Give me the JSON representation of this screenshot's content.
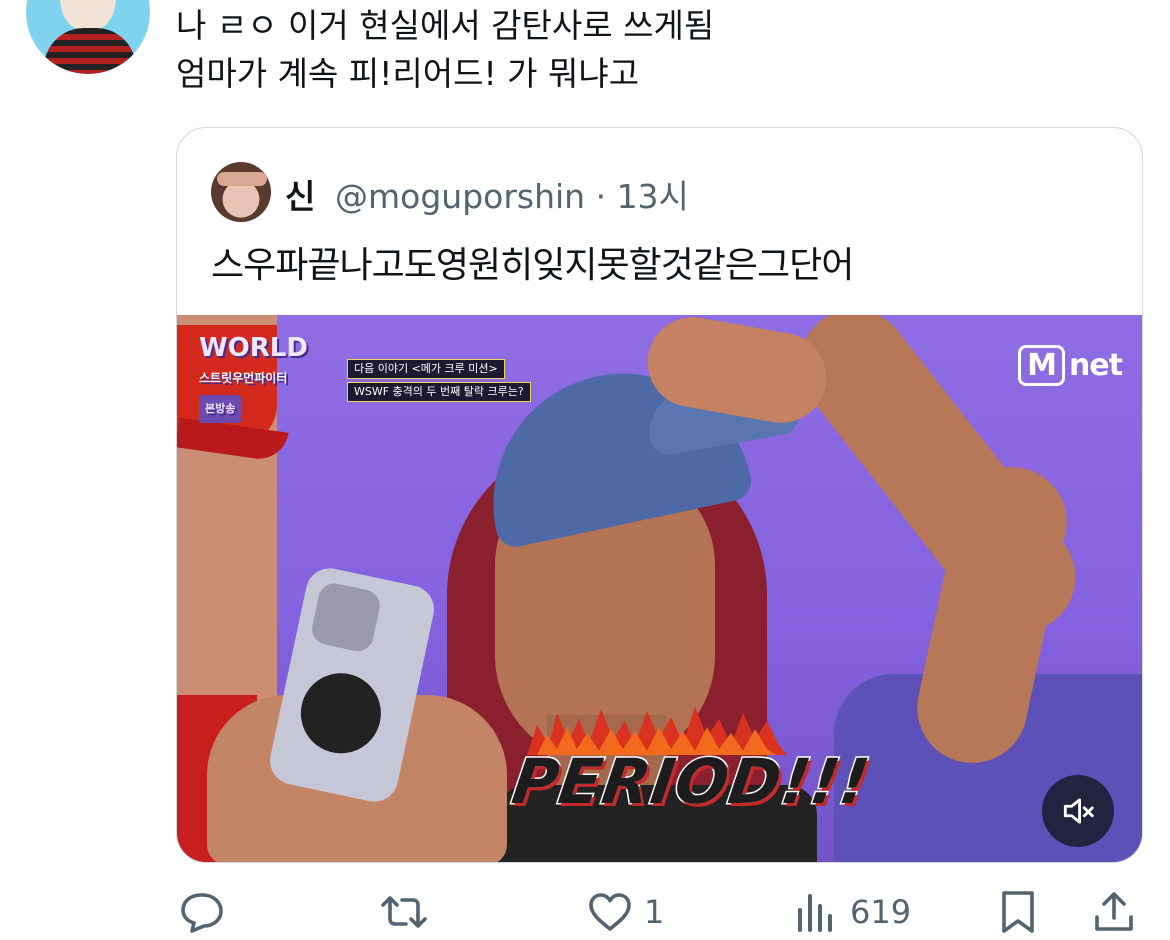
{
  "tweet": {
    "lines": [
      "나 ㄹㅇ 이거 현실에서 감탄사로 쓰게됨",
      "엄마가 계속 피!리어드! 가 뭐냐고"
    ]
  },
  "quoted_tweet": {
    "author_name": "신",
    "handle_time": "@moguporshin · 13시",
    "text": "스우파끝나고도영원히잊지못할것같은그단어",
    "media": {
      "caption": "PERIOD!!!",
      "show_logo": "WORLD",
      "show_title": "스트릿우먼파이터",
      "broadcast_tag": "본방송",
      "info_line1": "다음 이야기 <메가 크루 미션>",
      "info_line2": "WSWF 충격의 두 번째 탈락 크루는?",
      "channel_logo": "net",
      "channel_mark": "M",
      "mute_icon": "volume-muted-icon"
    }
  },
  "actions": {
    "reply_icon": "reply-icon",
    "retweet_icon": "retweet-icon",
    "like_icon": "heart-icon",
    "like_count": "1",
    "views_icon": "views-chart-icon",
    "views_count": "619",
    "bookmark_icon": "bookmark-icon",
    "share_icon": "share-icon"
  },
  "colors": {
    "text_primary": "#0f1419",
    "text_secondary": "#536471",
    "border": "#cfd9de",
    "media_bg": "#8a68e0"
  }
}
